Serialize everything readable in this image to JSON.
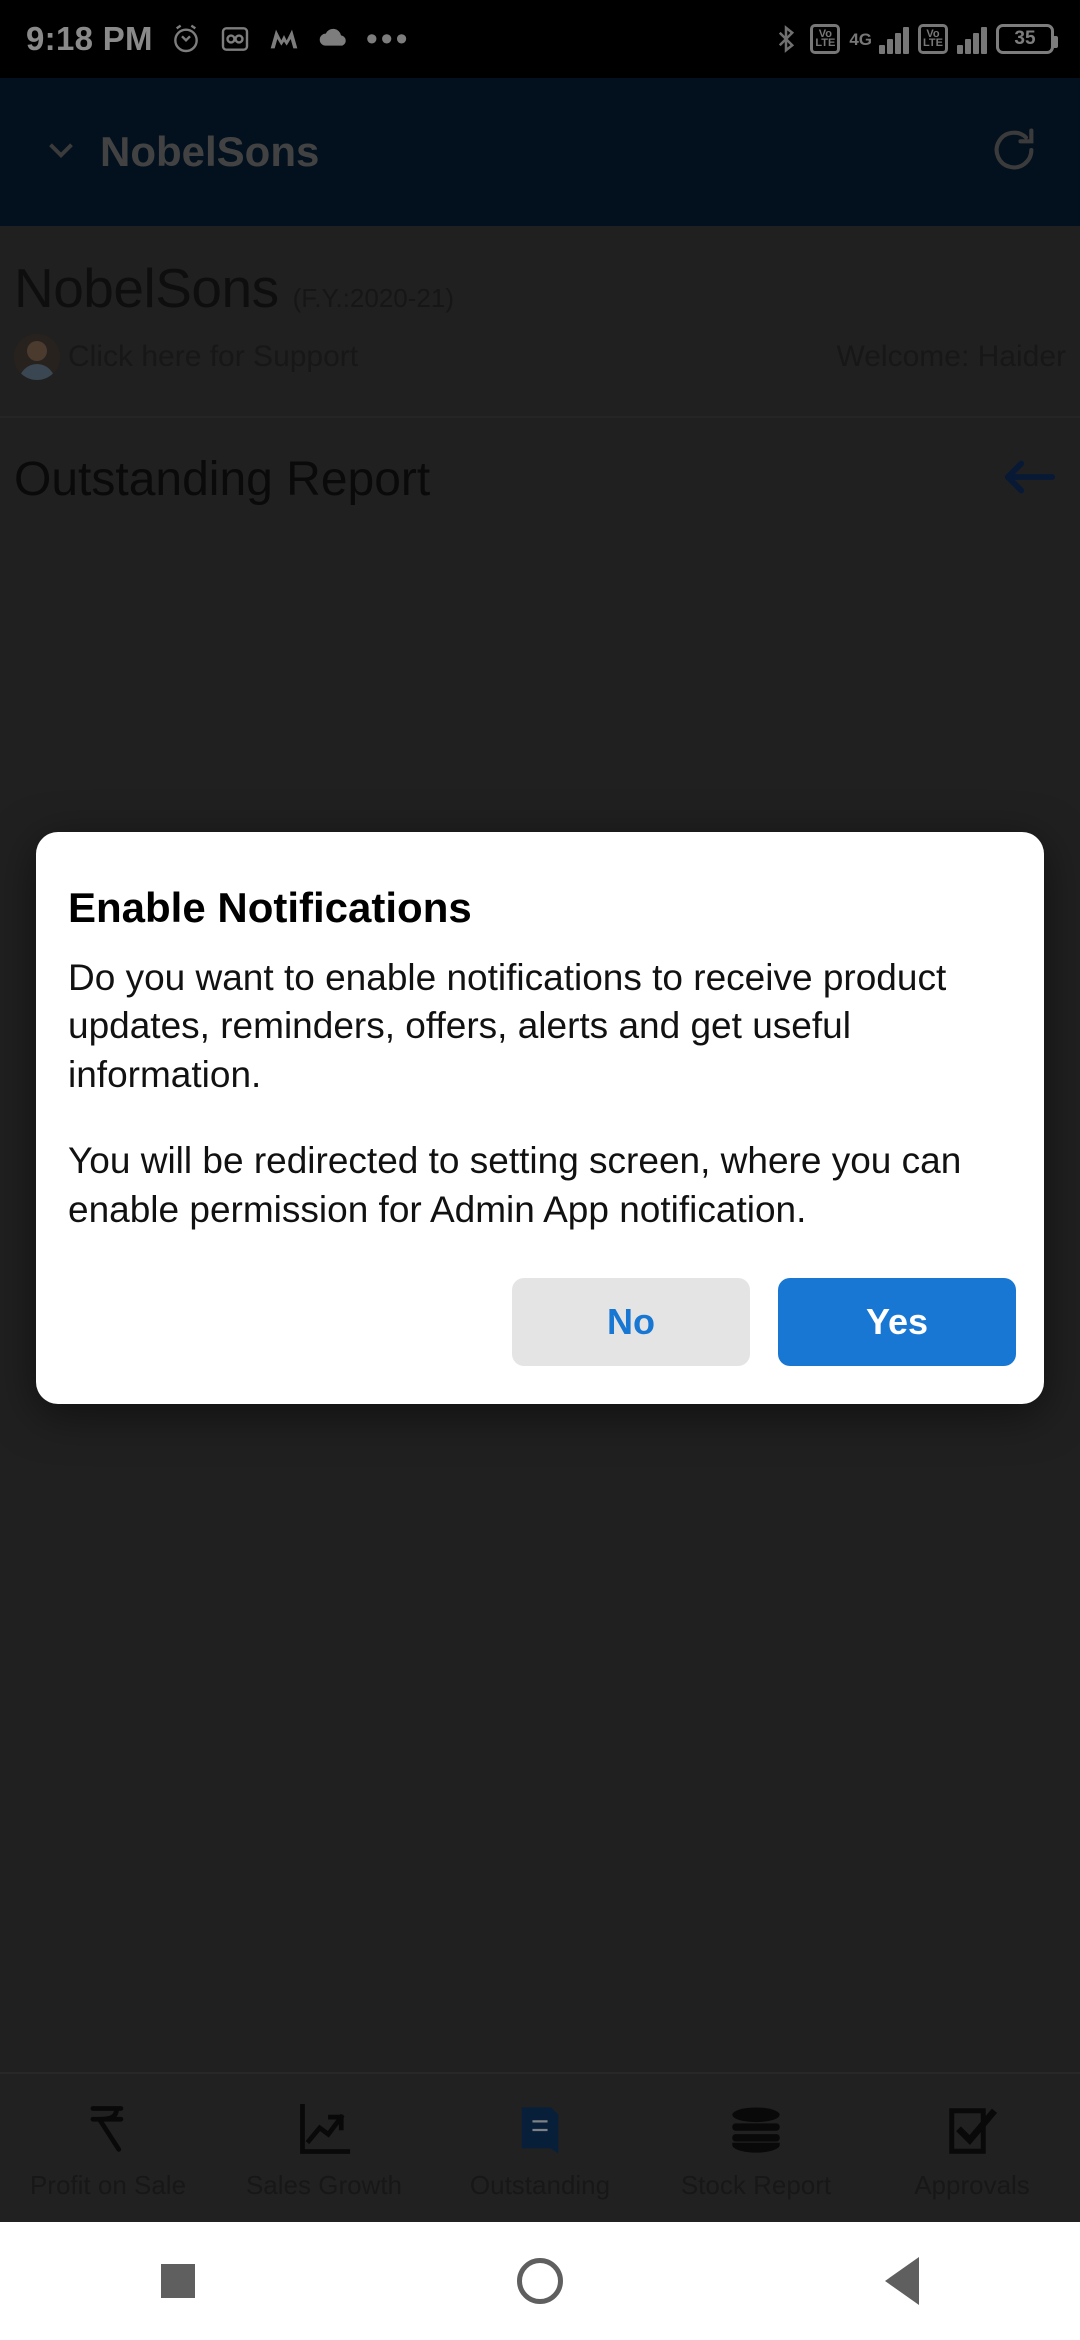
{
  "status_bar": {
    "time": "9:18 PM",
    "icons_left": [
      "alarm-icon",
      "voicemail-icon",
      "m-app-icon",
      "cloud-icon",
      "more-dots-icon"
    ],
    "bluetooth": "bluetooth-icon",
    "sim1_label": "4G",
    "volte_text": "Vo LTE",
    "battery_percent": "35"
  },
  "app_bar": {
    "title": "NobelSons",
    "chevron": "chevron-down-icon",
    "refresh": "refresh-icon"
  },
  "header": {
    "company_name": "NobelSons",
    "financial_year": "(F.Y.:2020-21)",
    "support_text": "Click here for Support",
    "welcome_text": "Welcome: Haider"
  },
  "page": {
    "title": "Outstanding Report",
    "back_icon": "back-arrow-icon"
  },
  "dialog": {
    "title": "Enable Notifications",
    "paragraph1": "Do you want to enable notifications to receive product updates, reminders, offers, alerts and get useful information.",
    "paragraph2": "You will be redirected to setting screen, where you can enable permission for Admin App notification.",
    "no_label": "No",
    "yes_label": "Yes",
    "accent_color": "#1877d2",
    "no_bg_color": "#e4e4e4"
  },
  "tabbar": {
    "items": [
      {
        "label": "Profit on Sale",
        "icon": "rupee-icon"
      },
      {
        "label": "Sales Growth",
        "icon": "line-chart-icon"
      },
      {
        "label": "Outstanding",
        "icon": "book-icon"
      },
      {
        "label": "Stock Report",
        "icon": "database-stack-icon"
      },
      {
        "label": "Approvals",
        "icon": "checkbox-check-icon"
      }
    ]
  },
  "android_nav": {
    "recent": "square-icon",
    "home": "circle-icon",
    "back": "triangle-back-icon"
  }
}
